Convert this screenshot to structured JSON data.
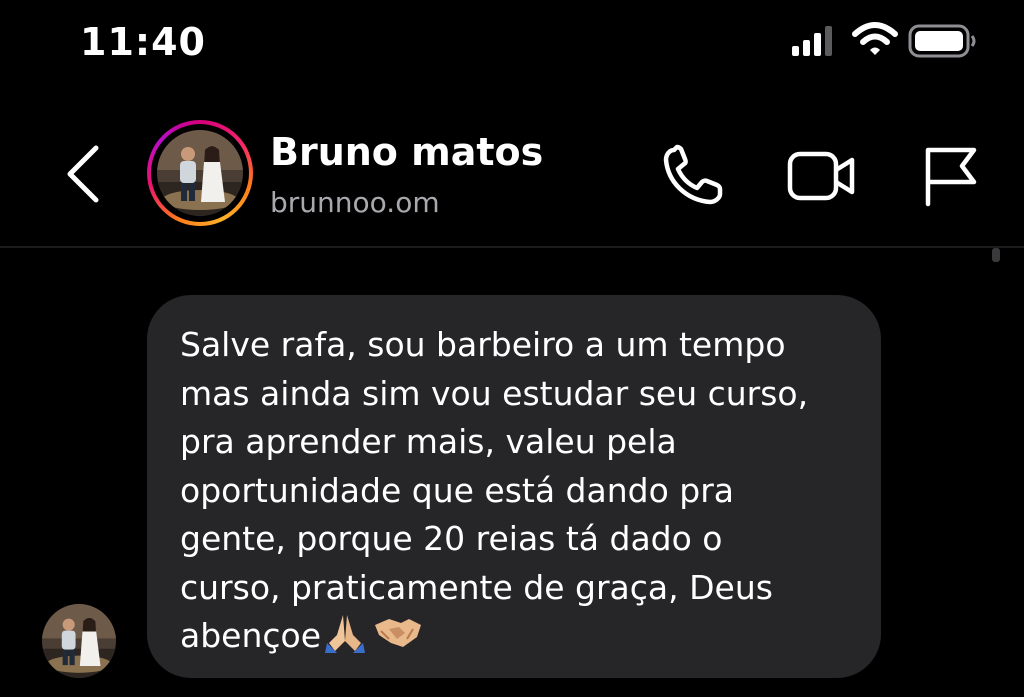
{
  "status_bar": {
    "time": "11:40",
    "signal_icon": "cellular-signal-icon",
    "wifi_icon": "wifi-icon",
    "battery_icon": "battery-icon"
  },
  "header": {
    "back_icon": "chevron-left-icon",
    "contact_name": "Bruno matos",
    "username": "brunnoo.om",
    "actions": [
      {
        "name": "audio-call",
        "icon": "phone-icon"
      },
      {
        "name": "video-call",
        "icon": "video-camera-icon"
      },
      {
        "name": "report",
        "icon": "flag-icon"
      }
    ]
  },
  "colors": {
    "background": "#000000",
    "bubble": "#262628",
    "secondary_text": "#a8a8ad",
    "story_ring": [
      "#d4007a",
      "#ff7a1a",
      "#ffb228",
      "#b90ec8"
    ]
  },
  "messages": [
    {
      "direction": "incoming",
      "text": "Salve rafa, sou barbeiro a um tempo\nmas ainda sim vou estudar seu curso,\npra aprender mais, valeu pela\noportunidade que está dando pra\ngente, porque 20 reias tá dado o\ncurso, praticamente de graça, Deus\nabençoe",
      "emojis": [
        "folded-hands-emoji",
        "handshake-emoji"
      ]
    }
  ]
}
